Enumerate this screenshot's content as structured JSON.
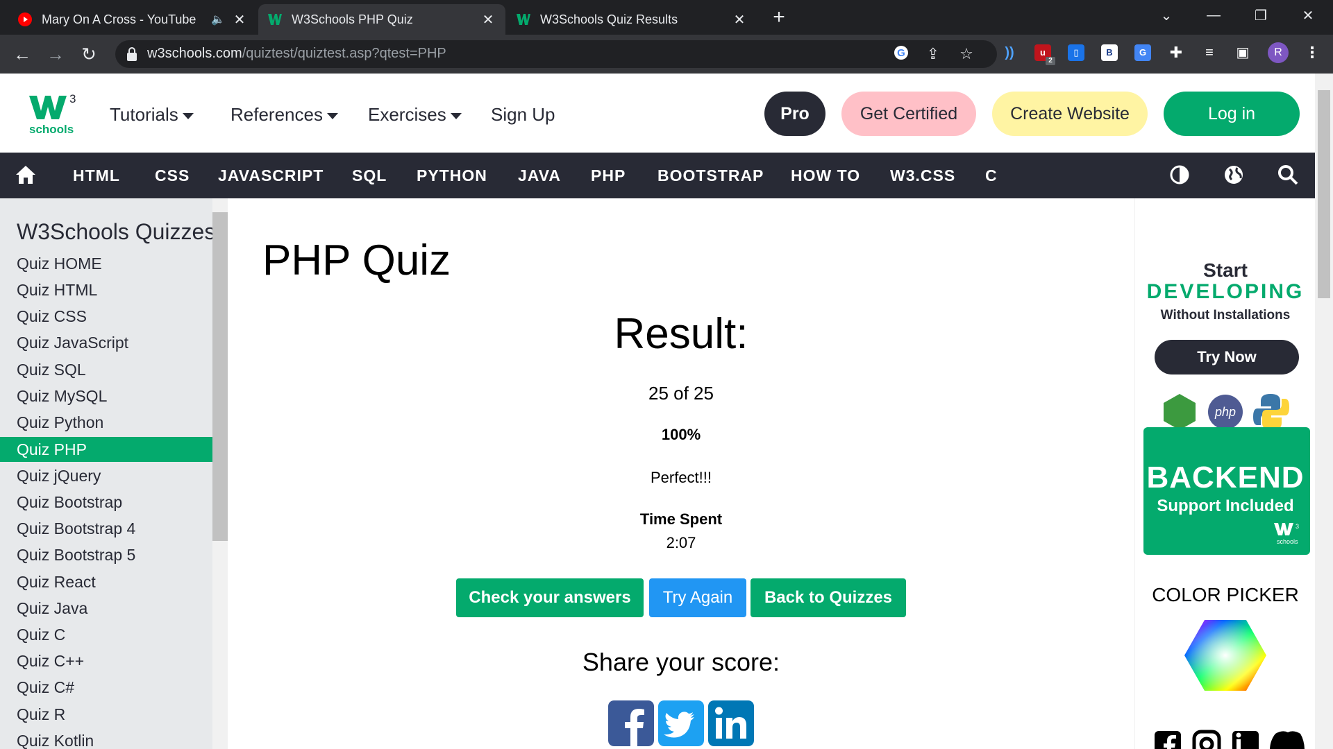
{
  "browser": {
    "tabs": [
      {
        "title": "Mary On A Cross - YouTube",
        "audio": "🔈",
        "active": false
      },
      {
        "title": "W3Schools PHP Quiz",
        "active": true
      },
      {
        "title": "W3Schools Quiz Results",
        "active": false
      }
    ],
    "new_tab": "+",
    "address": {
      "host": "w3schools.com",
      "path": "/quiztest/quiztest.asp?qtest=PHP"
    },
    "profile_initial": "R",
    "ext_ublock_badge": "2",
    "ext_b_label": "B"
  },
  "nav": {
    "logo_sup": "3",
    "logo_text": "schools",
    "menu": [
      "Tutorials",
      "References",
      "Exercises",
      "Sign Up"
    ],
    "pro": "Pro",
    "certified": "Get Certified",
    "create_website": "Create Website",
    "login": "Log in"
  },
  "subnav": [
    "HTML",
    "CSS",
    "JAVASCRIPT",
    "SQL",
    "PYTHON",
    "JAVA",
    "PHP",
    "BOOTSTRAP",
    "HOW TO",
    "W3.CSS",
    "C"
  ],
  "sidebar": {
    "heading": "W3Schools Quizzes",
    "items": [
      "Quiz HOME",
      "Quiz HTML",
      "Quiz CSS",
      "Quiz JavaScript",
      "Quiz SQL",
      "Quiz MySQL",
      "Quiz Python",
      "Quiz PHP",
      "Quiz jQuery",
      "Quiz Bootstrap",
      "Quiz Bootstrap 4",
      "Quiz Bootstrap 5",
      "Quiz React",
      "Quiz Java",
      "Quiz C",
      "Quiz C++",
      "Quiz C#",
      "Quiz R",
      "Quiz Kotlin"
    ],
    "active_index": 7
  },
  "main": {
    "title": "PHP Quiz",
    "result_label": "Result:",
    "score": "25 of 25",
    "percent": "100%",
    "verdict": "Perfect!!!",
    "time_label": "Time Spent",
    "time_value": "2:07",
    "buttons": {
      "check": "Check your answers",
      "again": "Try Again",
      "back": "Back to Quizzes"
    },
    "share_label": "Share your score:"
  },
  "ad": {
    "start": "Start",
    "developing": "DEVELOPING",
    "without": "Without Installations",
    "try_now": "Try Now",
    "php_label": "php",
    "backend": "BACKEND",
    "support": "Support Included",
    "w3_sup": "3",
    "w3_text": "schools",
    "color_picker": "COLOR PICKER"
  },
  "colors": {
    "brand_green": "#04aa6d",
    "dark": "#282a35",
    "certified_bg": "#ffc0c7",
    "create_bg": "#fff4a3",
    "try_again_blue": "#2196f3"
  }
}
